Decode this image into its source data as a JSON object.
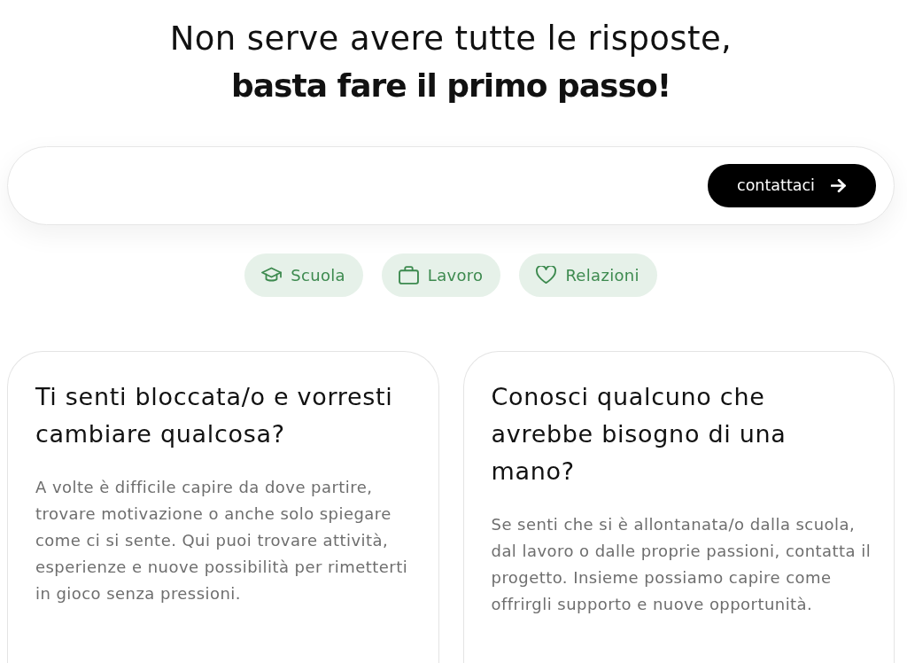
{
  "heading": {
    "line_1": "Non serve avere tutte le risposte,",
    "line_2": "basta fare il primo passo!"
  },
  "contact_bar": {
    "button": "contattaci"
  },
  "topics": [
    {
      "label": "Scuola"
    },
    {
      "label": "Lavoro"
    },
    {
      "label": "Relazioni"
    }
  ],
  "cards": [
    {
      "title": "Ti senti bloccata/o e vorresti cambiare qualcosa?",
      "text": "A volte è difficile capire da dove partire, trovare motivazione o anche solo spiegare come ci si sente. Qui puoi trovare attività, esperienze e nuove possibilità per rimetterti in gioco senza pressioni."
    },
    {
      "title": "Conosci qualcuno che avrebbe bisogno di una mano?",
      "text": "Se senti che si è allontanata/o dalla scuola, dal lavoro o dalle proprie passioni, contatta il progetto. Insieme possiamo capire come offrirgli supporto e nuove opportunità."
    }
  ]
}
